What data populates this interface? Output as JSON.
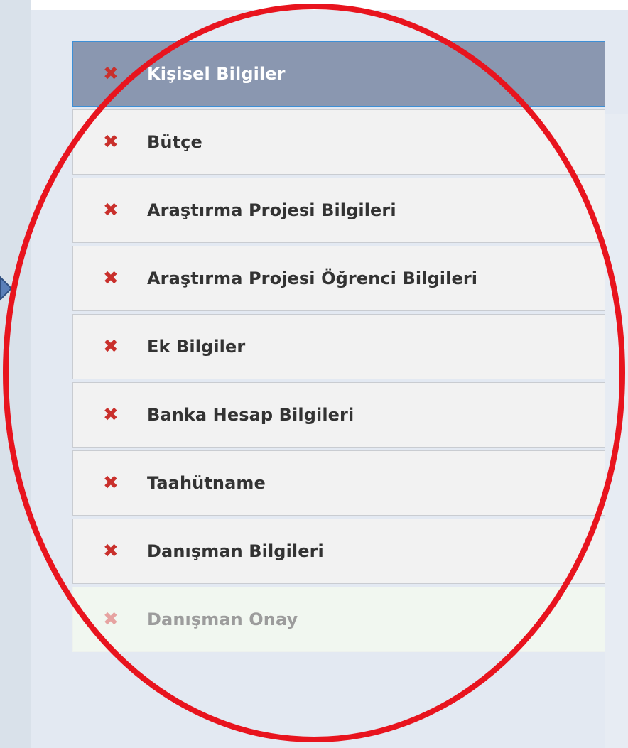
{
  "steps": [
    {
      "label": "Kişisel Bilgiler",
      "state": "active",
      "icon": "close-icon"
    },
    {
      "label": "Bütçe",
      "state": "incomplete",
      "icon": "close-icon"
    },
    {
      "label": "Araştırma Projesi Bilgileri",
      "state": "incomplete",
      "icon": "close-icon"
    },
    {
      "label": "Araştırma Projesi Öğrenci Bilgileri",
      "state": "incomplete",
      "icon": "close-icon"
    },
    {
      "label": "Ek Bilgiler",
      "state": "incomplete",
      "icon": "close-icon"
    },
    {
      "label": "Banka Hesap Bilgileri",
      "state": "incomplete",
      "icon": "close-icon"
    },
    {
      "label": "Taahütname",
      "state": "incomplete",
      "icon": "close-icon"
    },
    {
      "label": "Danışman Bilgileri",
      "state": "incomplete",
      "icon": "close-icon"
    },
    {
      "label": "Danışman Onay",
      "state": "disabled",
      "icon": "close-icon"
    }
  ],
  "icon_glyph": "✖",
  "colors": {
    "icon_red": "#c9302c",
    "active_bg": "#8a97b0",
    "annotation_red": "#e8141e"
  }
}
